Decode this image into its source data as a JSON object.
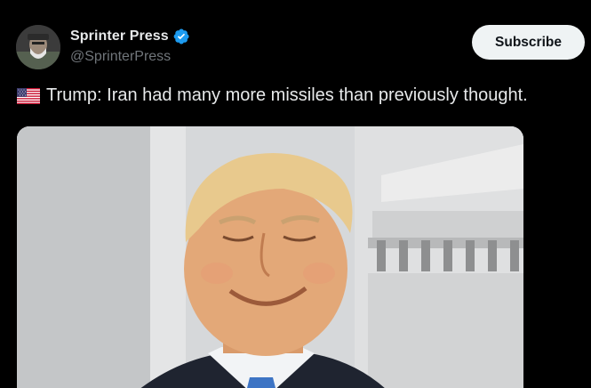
{
  "author": {
    "display_name": "Sprinter Press",
    "handle": "@SprinterPress",
    "avatar_icon": "user-avatar",
    "verified_icon": "verified-badge-icon",
    "verified_color": "#1d9bf0"
  },
  "actions": {
    "subscribe_label": "Subscribe"
  },
  "post": {
    "flag_icon": "us-flag-icon",
    "text": "Trump: Iran had many more missiles than previously thought."
  },
  "colors": {
    "background": "#000000",
    "text_primary": "#e7e9ea",
    "text_secondary": "#71767b",
    "button_bg": "#eff3f4"
  }
}
